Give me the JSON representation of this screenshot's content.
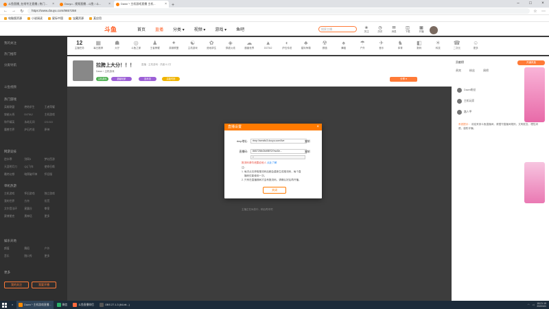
{
  "browser": {
    "tabs": [
      {
        "label": "斗鱼直播_在线专注直播 | 热门...",
        "active": false
      },
      {
        "label": "Douyu - 视频直播 - 斗鱼 / 斗...",
        "active": false
      },
      {
        "label": "Dawn丶主机游戏直播 主机...",
        "active": true
      }
    ],
    "new_tab": "+",
    "url": "https://www.douyu.com/8657258",
    "bookmarks": [
      "电脑版资源",
      "小说阅读",
      "星际中国",
      "宝藏资源",
      "某应用"
    ]
  },
  "site": {
    "logo": "斗鱼",
    "nav": [
      "首页",
      "直播",
      "分类 ▾",
      "视频 ▾",
      "游戏 ▾",
      "鱼吧"
    ],
    "active_nav": "直播",
    "search_placeholder": "搜索主播",
    "header_icons": [
      {
        "icon": "★",
        "label": "关注"
      },
      {
        "icon": "◷",
        "label": "历史"
      },
      {
        "icon": "✉",
        "label": "消息"
      },
      {
        "icon": "◫",
        "label": "下载"
      },
      {
        "icon": "▣",
        "label": "开播"
      }
    ]
  },
  "categories": [
    {
      "icon": "12",
      "label": "主播任务"
    },
    {
      "icon": "▦",
      "label": "每日推荐"
    },
    {
      "icon": "☗",
      "label": "大厅"
    },
    {
      "icon": "◎",
      "label": "斗鱼之家"
    },
    {
      "icon": "♟",
      "label": "王者荣耀"
    },
    {
      "icon": "✦",
      "label": "英雄联盟"
    },
    {
      "icon": "☯",
      "label": "主机游戏"
    },
    {
      "icon": "✿",
      "label": "绝地求生"
    },
    {
      "icon": "◈",
      "label": "穿越火线"
    },
    {
      "icon": "☁",
      "label": "魔兽世界"
    },
    {
      "icon": "▲",
      "label": "DOTA2"
    },
    {
      "icon": "◐",
      "label": "炉石传说"
    },
    {
      "icon": "♣",
      "label": "星际争霸"
    },
    {
      "icon": "☢",
      "label": "颜值"
    },
    {
      "icon": "♠",
      "label": "舞蹈"
    },
    {
      "icon": "☂",
      "label": "户外"
    },
    {
      "icon": "✈",
      "label": "音乐"
    },
    {
      "icon": "♞",
      "label": "体育"
    },
    {
      "icon": "◧",
      "label": "数码"
    },
    {
      "icon": "☀",
      "label": "科技"
    },
    {
      "icon": "☎",
      "label": "二次元"
    },
    {
      "icon": "☺",
      "label": "更多"
    }
  ],
  "sidebar": {
    "top_items": [
      "我的关注",
      "热门推荐",
      "分类导航",
      "斗鱼视频"
    ],
    "sections": [
      {
        "title": "热门游戏",
        "items": [
          "英雄联盟",
          "绝地求生",
          "王者荣耀",
          "穿越火线",
          "DOTA2",
          "主机游戏",
          "和平精英",
          "永劫无间",
          "CS:GO",
          "魔兽世界",
          "炉石传说",
          "原神"
        ]
      },
      {
        "title": "网游竞技",
        "items": [
          "逆水寒",
          "剑网3",
          "梦幻西游",
          "天涯明月刀",
          "QQ飞车",
          "使命召唤",
          "最终幻想",
          "暗黑破坏神",
          "怀旧服"
        ]
      },
      {
        "title": "单机热游",
        "items": [
          "主机游戏",
          "怀旧游戏",
          "独立游戏",
          "我的世界",
          "方舟",
          "饥荒",
          "艾尔登法环",
          "星露谷",
          "拳皇",
          "赛博朋克",
          "黑神话",
          "更多"
        ]
      },
      {
        "title": "娱乐天地",
        "items": [
          "颜值",
          "舞蹈",
          "户外",
          "音乐",
          "脱口秀",
          "更多"
        ]
      },
      {
        "title": "更多",
        "items": []
      }
    ],
    "btn_follow": "我的关注",
    "btn_open": "我要开播"
  },
  "room": {
    "title": "拉胯上大分！！！",
    "meta": "直播 · 主机游戏 · 热度 6.2万",
    "streamer": "Dawn丶主机游戏",
    "tags": [
      "主机游戏",
      "超级玩家",
      "技术流",
      "高能时刻"
    ],
    "share": "分享 ▾",
    "video_caption": "主播正在休息中，稍后再来吧"
  },
  "right_panel": {
    "heading": "贡献榜",
    "tabs": [
      "贵宾",
      "粉丝",
      "周榜"
    ],
    "ranks": [
      "Dawn粉丝",
      "主机玩家",
      "路人甲"
    ],
    "chat": [
      {
        "text": "系统提示：",
        "sys": true
      },
      {
        "text": "欢迎来到斗鱼直播间，请遵守直播间规则，文明发言，理性消费，谨防诈骗。",
        "sys": false
      }
    ],
    "btn_open": "开通贵族"
  },
  "modal": {
    "title": "直播设置",
    "close": "×",
    "rtmp_label": "rtmp地址:",
    "rtmp_value": "rtmp://sendtc3.douyu.com/live",
    "copy": "复制",
    "key_label": "直播码:",
    "key_value": "8657258rZkWBR2i?wsSe...",
    "copy2": "复制",
    "select_value": "▾",
    "warn_prefix": "推流码请勿泄露给他人",
    "warn_link": "点此了解",
    "note_title": "注：",
    "notes": [
      "1. 每次点击获取推流码后都会重新生成推流码，每个直",
      "播码仅能使用一次。",
      "2. 只有在直播期间才会有推流码，请确认好后再开播。"
    ],
    "ok": "关闭"
  },
  "taskbar": {
    "items": [
      {
        "label": "Dawn丶主机游戏直播...",
        "color": "#ff8a00",
        "active": true
      },
      {
        "label": "微信",
        "color": "#2aae67",
        "active": false
      },
      {
        "label": "斗鱼直播伴侣",
        "color": "#ff6a3d",
        "active": false
      },
      {
        "label": "OBS 27.1.3 (64-bit...)",
        "color": "#555555",
        "active": false
      }
    ],
    "time": "18:21:19",
    "date": "2022/4/1"
  },
  "colors": {
    "accent": "#ff7a00",
    "sidebar": "#2f2f2f",
    "video_bg": "#3d3d3d"
  }
}
